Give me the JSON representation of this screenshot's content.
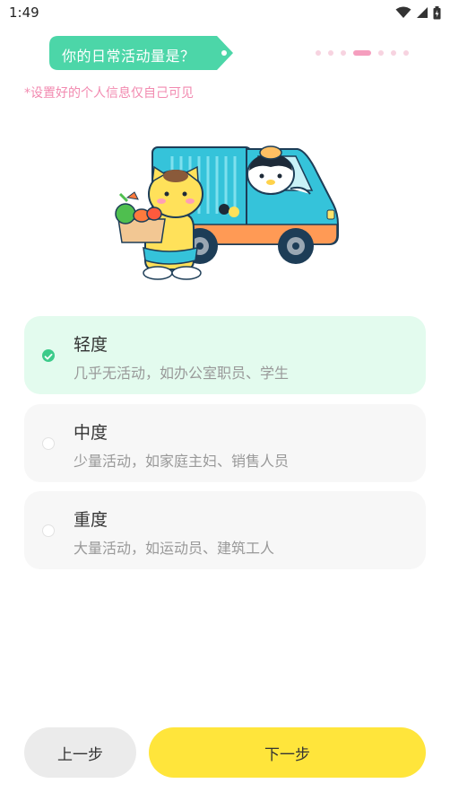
{
  "status_bar": {
    "time": "1:49",
    "icons": [
      "wifi-icon",
      "signal-icon",
      "battery-icon"
    ]
  },
  "question": "你的日常活动量是？",
  "progress": {
    "total_steps": 7,
    "current_step": 4
  },
  "hint": "*设置好的个人信息仅自己可见",
  "illustration": "cartoon-cats-delivery-truck",
  "options": [
    {
      "title": "轻度",
      "desc": "几乎无活动，如办公室职员、学生",
      "selected": true
    },
    {
      "title": "中度",
      "desc": "少量活动，如家庭主妇、销售人员",
      "selected": false
    },
    {
      "title": "重度",
      "desc": "大量活动，如运动员、建筑工人",
      "selected": false
    }
  ],
  "buttons": {
    "prev": "上一步",
    "next": "下一步"
  },
  "colors": {
    "bubble": "#4cd6a8",
    "selected_bg": "#e3fbee",
    "check": "#3ccb8a",
    "hint": "#f28ab0",
    "next_button": "#ffe53b",
    "prev_button": "#ebebeb",
    "step_active": "#f59ebe"
  }
}
